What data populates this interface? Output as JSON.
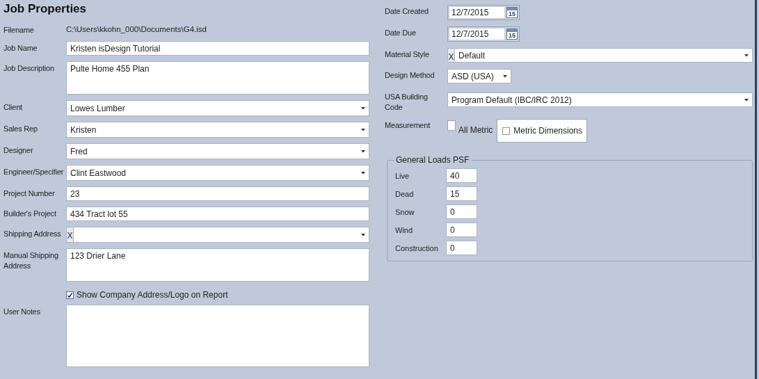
{
  "title": "Job Properties",
  "left_fields": [
    {
      "kind": "static",
      "label": "Filename",
      "value": "C:\\Users\\kkohn_000\\Documents\\G4.isd"
    },
    {
      "kind": "text",
      "label": "Job Name",
      "value": "Kristen isDesign Tutorial"
    },
    {
      "kind": "textarea",
      "label": "Job Description",
      "value": "Pulte Home 455 Plan"
    },
    {
      "kind": "combo",
      "label": "Client",
      "value": "Lowes Lumber"
    },
    {
      "kind": "combo",
      "label": "Sales Rep",
      "value": "Kristen"
    },
    {
      "kind": "combo",
      "label": "Designer",
      "value": "Fred"
    },
    {
      "kind": "combo",
      "label": "Engineer/Specifier",
      "value": "Clint Eastwood"
    },
    {
      "kind": "text",
      "label": "Project Number",
      "value": "23"
    },
    {
      "kind": "text",
      "label": "Builder's Project",
      "value": "434 Tract lot 55"
    },
    {
      "kind": "clearable",
      "label": "Shipping Address",
      "clear": "X"
    },
    {
      "kind": "textarea",
      "label": "Manual Shipping Address",
      "value": "123 Drier Lane"
    },
    {
      "kind": "checkbox",
      "label": "Show Company Address/Logo on Report",
      "checked": true
    },
    {
      "kind": "notes",
      "label": "User Notes"
    }
  ],
  "right_fields": [
    {
      "kind": "date",
      "label": "Date Created",
      "value": "12/7/2015",
      "icon_text": "15"
    },
    {
      "kind": "date",
      "label": "Date Due",
      "value": "12/7/2015",
      "icon_text": "15"
    },
    {
      "kind": "clearable",
      "label": "Material Style",
      "clear": "X",
      "value": "Default"
    },
    {
      "kind": "short_combo",
      "label": "Design Method",
      "value": "ASD (USA)"
    },
    {
      "kind": "combo",
      "label": "USA Building Code",
      "value": "Program Default (IBC/IRC 2012)"
    },
    {
      "kind": "measurement",
      "label": "Measurement",
      "options": [
        {
          "label": "All Metric",
          "checked": false
        },
        {
          "label": "Metric Dimensions",
          "checked": false
        }
      ]
    }
  ],
  "loads": {
    "title": "General Loads PSF",
    "rows": [
      {
        "label": "Live",
        "value": "40"
      },
      {
        "label": "Dead",
        "value": "15"
      },
      {
        "label": "Snow",
        "value": "0"
      },
      {
        "label": "Wind",
        "value": "0"
      },
      {
        "label": "Construction",
        "value": "0"
      }
    ]
  }
}
